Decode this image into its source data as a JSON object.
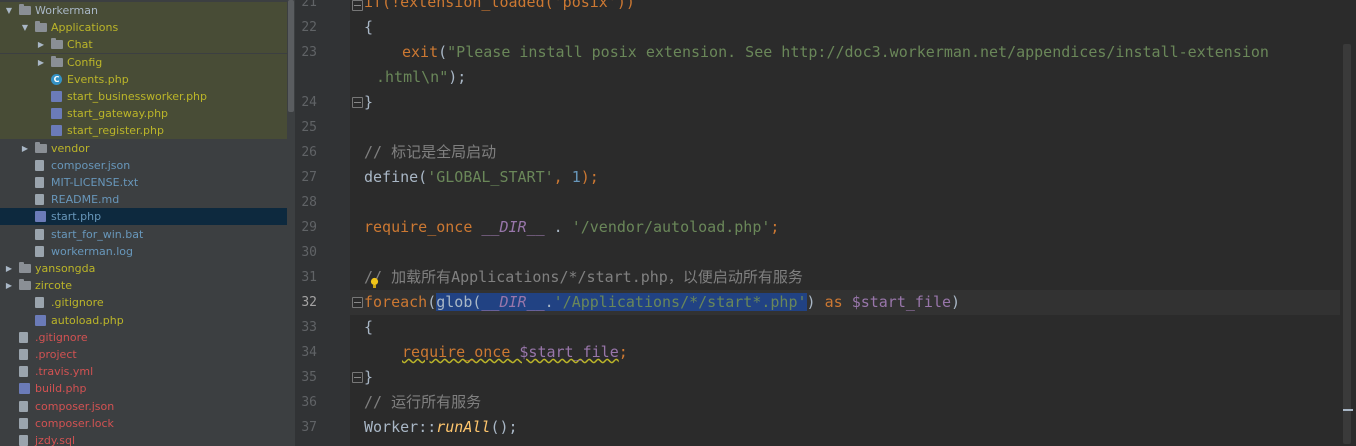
{
  "project_tree": {
    "items": [
      {
        "label": "Workerman",
        "indent": 0,
        "arrow": "down",
        "icon": "folder-icon",
        "color": "plain",
        "hl": true
      },
      {
        "label": "Applications",
        "indent": 1,
        "arrow": "down",
        "icon": "folder-icon",
        "color": "yellow",
        "hl": true
      },
      {
        "label": "Chat",
        "indent": 2,
        "arrow": "right",
        "icon": "folder-icon",
        "color": "yellow",
        "hl": true
      },
      {
        "label": "Config",
        "indent": 2,
        "arrow": "right",
        "icon": "folder-icon",
        "color": "yellow",
        "hl": true
      },
      {
        "label": "Events.php",
        "indent": 2,
        "arrow": "",
        "icon": "php-class-icon",
        "color": "yellow",
        "hl": true
      },
      {
        "label": "start_businessworker.php",
        "indent": 2,
        "arrow": "",
        "icon": "php-file-icon",
        "color": "yellow",
        "hl": true
      },
      {
        "label": "start_gateway.php",
        "indent": 2,
        "arrow": "",
        "icon": "php-file-icon",
        "color": "yellow",
        "hl": true
      },
      {
        "label": "start_register.php",
        "indent": 2,
        "arrow": "",
        "icon": "php-file-icon",
        "color": "yellow",
        "hl": true
      },
      {
        "label": "vendor",
        "indent": 1,
        "arrow": "right",
        "icon": "folder-icon",
        "color": "yellow",
        "hl": false
      },
      {
        "label": "composer.json",
        "indent": 1,
        "arrow": "",
        "icon": "json-file-icon",
        "color": "blue",
        "hl": false
      },
      {
        "label": "MIT-LICENSE.txt",
        "indent": 1,
        "arrow": "",
        "icon": "text-file-icon",
        "color": "blue",
        "hl": false
      },
      {
        "label": "README.md",
        "indent": 1,
        "arrow": "",
        "icon": "markdown-file-icon",
        "color": "blue",
        "hl": false
      },
      {
        "label": "start.php",
        "indent": 1,
        "arrow": "",
        "icon": "php-file-icon",
        "color": "blue",
        "sel": true
      },
      {
        "label": "start_for_win.bat",
        "indent": 1,
        "arrow": "",
        "icon": "bat-file-icon",
        "color": "blue",
        "hl": false
      },
      {
        "label": "workerman.log",
        "indent": 1,
        "arrow": "",
        "icon": "log-file-icon",
        "color": "blue",
        "hl": false
      },
      {
        "label": "yansongda",
        "indent": 0,
        "arrow": "right",
        "icon": "folder-icon",
        "color": "yellow",
        "hl": false
      },
      {
        "label": "zircote",
        "indent": 0,
        "arrow": "right",
        "icon": "folder-icon",
        "color": "yellow",
        "hl": false
      },
      {
        "label": ".gitignore",
        "indent": 1,
        "arrow": "",
        "icon": "gitignore-file-icon",
        "color": "yellow",
        "hl": false
      },
      {
        "label": "autoload.php",
        "indent": 1,
        "arrow": "",
        "icon": "php-file-icon",
        "color": "yellow",
        "hl": false
      },
      {
        "label": ".gitignore",
        "indent": 0,
        "arrow": "",
        "icon": "gitignore-file-icon",
        "color": "red",
        "hl": false
      },
      {
        "label": ".project",
        "indent": 0,
        "arrow": "",
        "icon": "text-file-icon",
        "color": "red",
        "hl": false
      },
      {
        "label": ".travis.yml",
        "indent": 0,
        "arrow": "",
        "icon": "yml-file-icon",
        "color": "red",
        "hl": false
      },
      {
        "label": "build.php",
        "indent": 0,
        "arrow": "",
        "icon": "php-file-icon",
        "color": "red",
        "hl": false
      },
      {
        "label": "composer.json",
        "indent": 0,
        "arrow": "",
        "icon": "json-file-icon",
        "color": "red",
        "hl": false
      },
      {
        "label": "composer.lock",
        "indent": 0,
        "arrow": "",
        "icon": "lock-file-icon",
        "color": "red",
        "hl": false
      },
      {
        "label": "jzdy.sql",
        "indent": 0,
        "arrow": "",
        "icon": "sql-file-icon",
        "color": "red",
        "hl": false
      }
    ]
  },
  "editor": {
    "line_numbers": [
      "21",
      "22",
      "23",
      "",
      "24",
      "25",
      "26",
      "27",
      "28",
      "29",
      "30",
      "31",
      "32",
      "33",
      "34",
      "35",
      "36",
      "37"
    ],
    "current_line": "32",
    "code": {
      "l21": "if(!extension_loaded('posix'))",
      "l22": "{",
      "l23a_fn": "exit",
      "l23a_str": "\"Please install posix extension. See http://doc3.workerman.net/appendices/install-extension",
      "l23b_str": ".html\\n\"",
      "l23b_end": ");",
      "l24": "}",
      "l26": "// 标记是全局启动",
      "l27_fn": "define(",
      "l27_str": "'GLOBAL_START'",
      "l27_sep": ", ",
      "l27_num": "1",
      "l27_end": ");",
      "l29_kw": "require_once",
      "l29_con": "__DIR__",
      "l29_dot": " . ",
      "l29_str": "'/vendor/autoload.php'",
      "l29_end": ";",
      "l31": "// 加载所有Applications/*/start.php，以便启动所有服务",
      "l32_kw": "foreach",
      "l32_p": "(",
      "l32_fn": "glob(",
      "l32_con": "__DIR__",
      "l32_dot": ".",
      "l32_str": "'/Applications/*/start*.php'",
      "l32_close": ")",
      "l32_as": " as ",
      "l32_var": "$start_file",
      "l32_end": ")",
      "l33": "{",
      "l34_kw": "require_once",
      "l34_var": "$start_file",
      "l34_end": ";",
      "l35": "}",
      "l36": "// 运行所有服务",
      "l37_cls": "Worker",
      "l37_sep": "::",
      "l37_mth": "runAll",
      "l37_end": "();"
    }
  }
}
